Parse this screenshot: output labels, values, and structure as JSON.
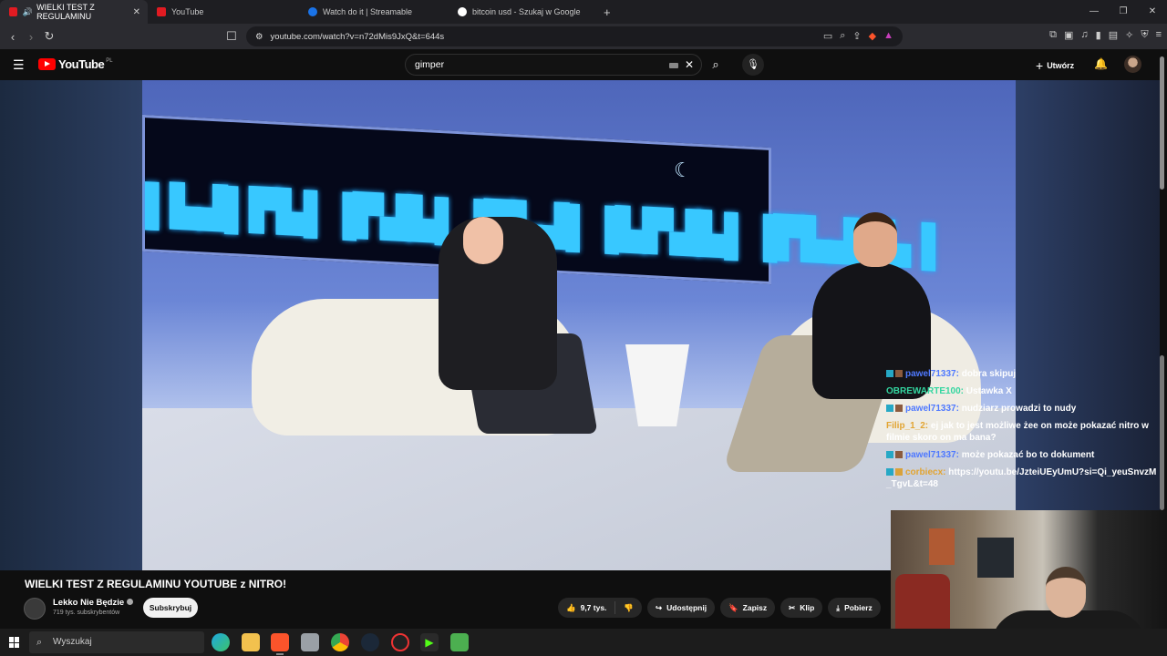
{
  "browser": {
    "tabs": [
      {
        "label": "WIELKI TEST Z REGULAMINU",
        "color": "#e11b22"
      },
      {
        "label": "YouTube",
        "color": "#e11b22"
      },
      {
        "label": "Watch do it | Streamable",
        "color": "#1a73e8"
      },
      {
        "label": "bitcoin usd - Szukaj w Google",
        "color": "#ffffff"
      }
    ],
    "url": "youtube.com/watch?v=n72dMis9JxQ&t=644s"
  },
  "youtube": {
    "logo_text": "YouTube",
    "region": "PL",
    "search_value": "gimper",
    "create_label": "Utwórz"
  },
  "chat": [
    {
      "user": "pawel71337:",
      "msg": "dobra skipuj",
      "badges": true
    },
    {
      "user": "OBREWARTE100:",
      "msg": "Ustawka X",
      "badges": false
    },
    {
      "user": "pawel71337:",
      "msg": "nudziarz prowadzi to nudy",
      "badges": true
    },
    {
      "user": "Filip_1_2:",
      "msg": "ej jak to jest możliwe żee on może pokazać nitro w filmie skoro on ma bana?",
      "badges": false
    },
    {
      "user": "pawel71337:",
      "msg": "może pokazać bo to dokument",
      "badges": true
    },
    {
      "user": "corbiecx:",
      "msg": "https://youtu.be/JzteiUEyUmU?si=Qi_yeuSnvzM_TgvL&t=48",
      "badges": true
    }
  ],
  "video": {
    "title": "WIELKI TEST Z REGULAMINU YOUTUBE z NITRO!",
    "channel": "Lekko Nie Będzie",
    "subscribers": "719 tys. subskrybentów",
    "subscribe_label": "Subskrybuj",
    "likes": "9,7 tys.",
    "share_label": "Udostępnij",
    "save_label": "Zapisz",
    "clip_label": "Klip",
    "download_label": "Pobierz"
  },
  "taskbar": {
    "search_placeholder": "Wyszukaj"
  }
}
